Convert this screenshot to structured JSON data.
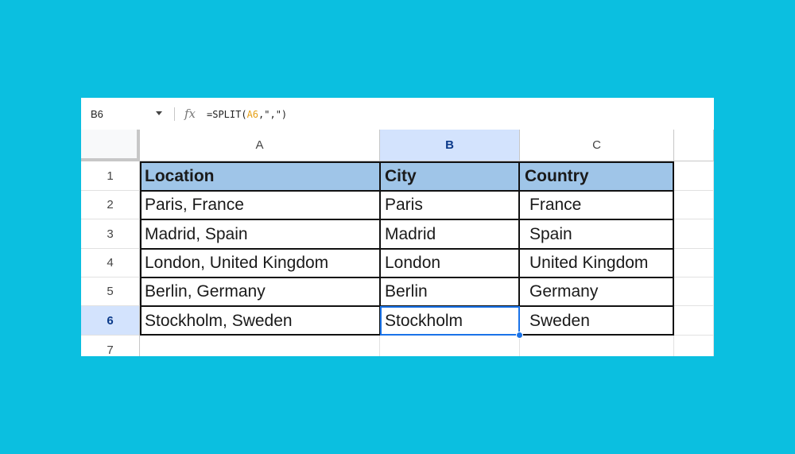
{
  "formula_bar": {
    "cell_ref": "B6",
    "fx_icon": "fx-icon",
    "formula_prefix": "=SPLIT(",
    "formula_ref": "A6",
    "formula_suffix": ",\",\")"
  },
  "columns": [
    "A",
    "B",
    "C"
  ],
  "selected_column": "B",
  "rows": [
    "1",
    "2",
    "3",
    "4",
    "5",
    "6",
    "7"
  ],
  "selected_row": "6",
  "table": {
    "headers": [
      "Location",
      "City",
      "Country"
    ],
    "rows": [
      [
        "Paris, France",
        "Paris",
        "France"
      ],
      [
        "Madrid, Spain",
        "Madrid",
        "Spain"
      ],
      [
        "London, United Kingdom",
        "London",
        "United Kingdom"
      ],
      [
        "Berlin, Germany",
        "Berlin",
        "Germany"
      ],
      [
        "Stockholm, Sweden",
        "Stockholm",
        "Sweden"
      ]
    ]
  },
  "colors": {
    "background": "#0bbfe0",
    "header_fill": "#9fc5e8",
    "selection": "#1a73e8",
    "selected_header": "#d3e3fd"
  }
}
